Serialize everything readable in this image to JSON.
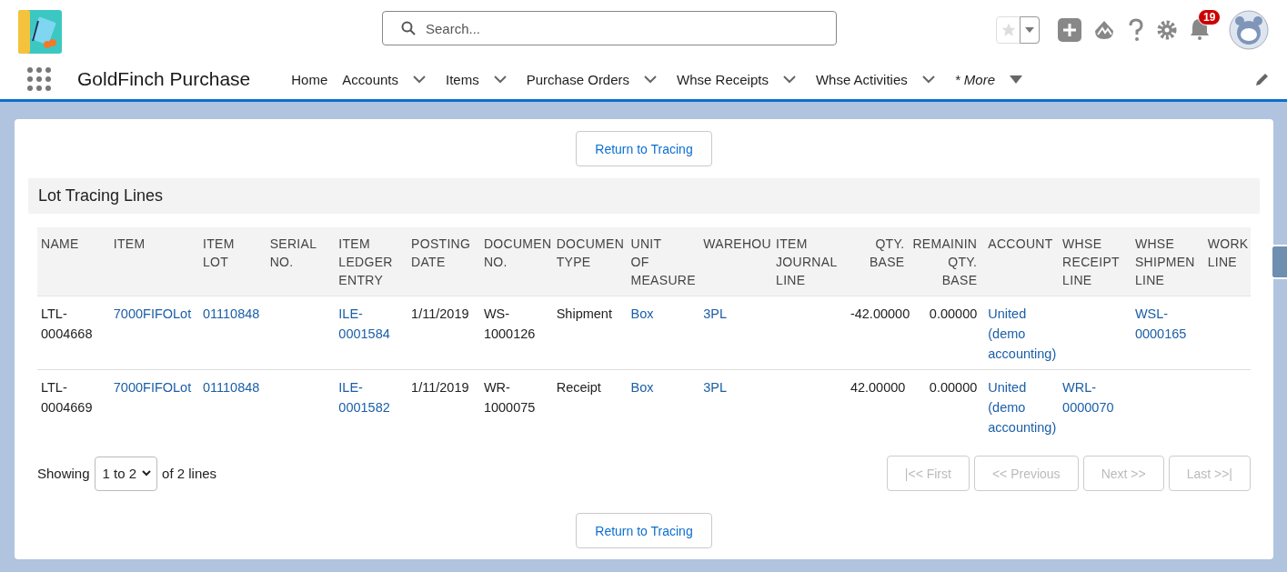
{
  "header": {
    "search": {
      "placeholder": "Search..."
    },
    "notifications": {
      "count": "19"
    }
  },
  "nav": {
    "app_name": "GoldFinch Purchase",
    "items": [
      {
        "label": "Home",
        "kind": "plain"
      },
      {
        "label": "Accounts",
        "kind": "menu"
      },
      {
        "label": "Items",
        "kind": "menu"
      },
      {
        "label": "Purchase Orders",
        "kind": "menu"
      },
      {
        "label": "Whse Receipts",
        "kind": "menu"
      },
      {
        "label": "Whse Activities",
        "kind": "menu"
      },
      {
        "label": "* More",
        "kind": "more"
      }
    ]
  },
  "top_button": "Return to Tracing",
  "section_title": "Lot Tracing Lines",
  "table": {
    "columns": [
      {
        "lines": [
          "NAME"
        ],
        "numeric": false
      },
      {
        "lines": [
          "ITEM"
        ],
        "numeric": false
      },
      {
        "lines": [
          "ITEM",
          "LOT"
        ],
        "numeric": false
      },
      {
        "lines": [
          "SERIAL",
          "NO."
        ],
        "numeric": false
      },
      {
        "lines": [
          "ITEM",
          "LEDGER",
          "ENTRY"
        ],
        "numeric": false
      },
      {
        "lines": [
          "POSTING",
          "DATE"
        ],
        "numeric": false
      },
      {
        "lines": [
          "DOCUMEN",
          "NO."
        ],
        "numeric": false
      },
      {
        "lines": [
          "DOCUMEN",
          "TYPE"
        ],
        "numeric": false
      },
      {
        "lines": [
          "UNIT",
          "OF",
          "MEASURE"
        ],
        "numeric": false
      },
      {
        "lines": [
          "WAREHOU"
        ],
        "numeric": false
      },
      {
        "lines": [
          "ITEM",
          "JOURNAL",
          "LINE"
        ],
        "numeric": false
      },
      {
        "lines": [
          "QTY.",
          "BASE"
        ],
        "numeric": true
      },
      {
        "lines": [
          "REMAININ",
          "QTY.",
          "BASE"
        ],
        "numeric": true
      },
      {
        "lines": [
          "ACCOUNT"
        ],
        "numeric": false
      },
      {
        "lines": [
          "WHSE",
          "RECEIPT",
          "LINE"
        ],
        "numeric": false
      },
      {
        "lines": [
          "WHSE",
          "SHIPMEN",
          "LINE"
        ],
        "numeric": false
      },
      {
        "lines": [
          "WORK",
          "LINE"
        ],
        "numeric": false
      }
    ],
    "rows": [
      {
        "cells": [
          {
            "text": "LTL-0004668",
            "link": false
          },
          {
            "text": "7000FIFOLot",
            "link": true
          },
          {
            "text": "01110848",
            "link": true
          },
          null,
          {
            "text": "ILE-0001584",
            "link": true
          },
          {
            "text": "1/11/2019",
            "link": false
          },
          {
            "text": "WS-1000126",
            "link": false
          },
          {
            "text": "Shipment",
            "link": false
          },
          {
            "text": "Box",
            "link": true
          },
          {
            "text": "3PL",
            "link": true
          },
          null,
          {
            "text": "-42.00000",
            "link": false
          },
          {
            "text": "0.00000",
            "link": false
          },
          {
            "text": "United (demo accounting)",
            "link": true
          },
          null,
          {
            "text": "WSL-0000165",
            "link": true
          },
          null
        ]
      },
      {
        "cells": [
          {
            "text": "LTL-0004669",
            "link": false
          },
          {
            "text": "7000FIFOLot",
            "link": true
          },
          {
            "text": "01110848",
            "link": true
          },
          null,
          {
            "text": "ILE-0001582",
            "link": true
          },
          {
            "text": "1/11/2019",
            "link": false
          },
          {
            "text": "WR-1000075",
            "link": false
          },
          {
            "text": "Receipt",
            "link": false
          },
          {
            "text": "Box",
            "link": true
          },
          {
            "text": "3PL",
            "link": true
          },
          null,
          {
            "text": "42.00000",
            "link": false
          },
          {
            "text": "0.00000",
            "link": false
          },
          {
            "text": "United (demo accounting)",
            "link": true
          },
          {
            "text": "WRL-0000070",
            "link": true
          },
          null,
          null
        ]
      }
    ]
  },
  "pager": {
    "showing": "Showing",
    "range": "1 to 2",
    "of": "of 2 lines",
    "buttons": [
      {
        "label": "|<< First",
        "disabled": true
      },
      {
        "label": "<< Previous",
        "disabled": true
      },
      {
        "label": "Next >>",
        "disabled": true
      },
      {
        "label": "Last >>|",
        "disabled": true
      }
    ]
  },
  "bottom_button": "Return to Tracing"
}
